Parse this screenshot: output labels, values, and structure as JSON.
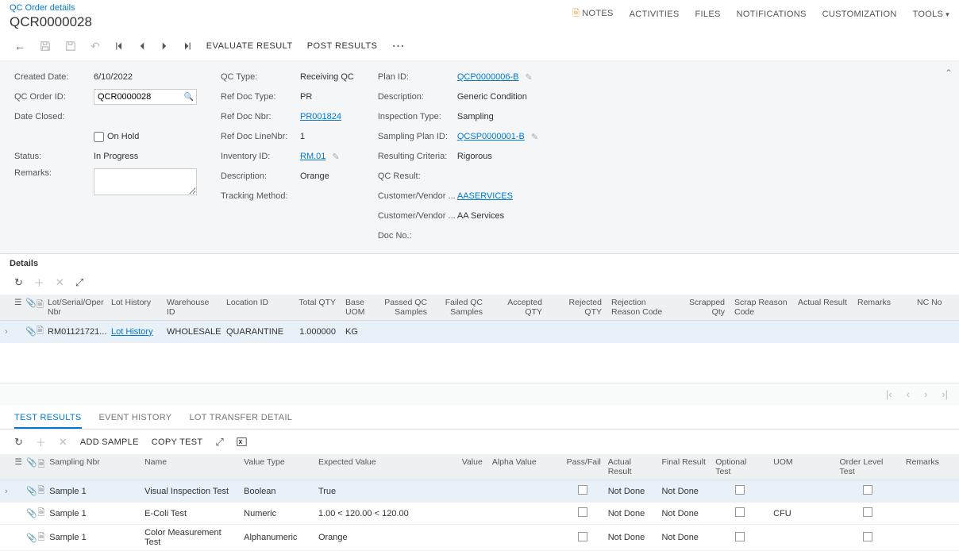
{
  "header": {
    "breadcrumb": "QC Order details",
    "title": "QCR0000028",
    "nav": {
      "notes": "NOTES",
      "activities": "ACTIVITIES",
      "files": "FILES",
      "notifications": "NOTIFICATIONS",
      "customization": "CUSTOMIZATION",
      "tools": "TOOLS"
    }
  },
  "toolbar": {
    "evaluate": "EVALUATE RESULT",
    "post": "POST RESULTS"
  },
  "form": {
    "created_date_label": "Created Date:",
    "created_date": "6/10/2022",
    "qc_order_id_label": "QC Order ID:",
    "qc_order_id": "QCR0000028",
    "date_closed_label": "Date Closed:",
    "date_closed": "",
    "on_hold_label": "On Hold",
    "status_label": "Status:",
    "status": "In Progress",
    "remarks_label": "Remarks:",
    "remarks": "",
    "qc_type_label": "QC Type:",
    "qc_type": "Receiving QC",
    "ref_doc_type_label": "Ref Doc Type:",
    "ref_doc_type": "PR",
    "ref_doc_nbr_label": "Ref Doc Nbr:",
    "ref_doc_nbr": "PR001824",
    "ref_doc_line_label": "Ref Doc LineNbr:",
    "ref_doc_line": "1",
    "inventory_id_label": "Inventory ID:",
    "inventory_id": "RM.01",
    "description_label": "Description:",
    "description": "Orange",
    "tracking_method_label": "Tracking Method:",
    "tracking_method": "",
    "plan_id_label": "Plan ID:",
    "plan_id": "QCP0000006-B",
    "plan_desc_label": "Description:",
    "plan_desc": "Generic Condition",
    "inspection_type_label": "Inspection Type:",
    "inspection_type": "Sampling",
    "sampling_plan_label": "Sampling Plan ID:",
    "sampling_plan": "QCSP0000001-B",
    "resulting_criteria_label": "Resulting Criteria:",
    "resulting_criteria": "Rigorous",
    "qc_result_label": "QC Result:",
    "qc_result": "",
    "cust_vendor_id_label": "Customer/Vendor ...",
    "cust_vendor_id": "AASERVICES",
    "cust_vendor_name_label": "Customer/Vendor ...",
    "cust_vendor_name": "AA Services",
    "doc_no_label": "Doc No.:",
    "doc_no": ""
  },
  "details": {
    "title": "Details",
    "columns": {
      "lot_serial": "Lot/Serial/Oper Nbr",
      "lot_history": "Lot History",
      "warehouse": "Warehouse ID",
      "location": "Location ID",
      "total_qty": "Total QTY",
      "base_uom": "Base UOM",
      "passed_qc": "Passed QC Samples",
      "failed_qc": "Failed QC Samples",
      "accepted_qty": "Accepted QTY",
      "rejected_qty": "Rejected QTY",
      "rejection_reason": "Rejection Reason Code",
      "scrapped_qty": "Scrapped Qty",
      "scrap_reason": "Scrap Reason Code",
      "actual_result": "Actual Result",
      "remarks": "Remarks",
      "nc_no": "NC No"
    },
    "rows": [
      {
        "lot_serial": "RM01121721...",
        "lot_history": "Lot History",
        "warehouse": "WHOLESALE",
        "location": "QUARANTINE",
        "total_qty": "1.000000",
        "base_uom": "KG"
      }
    ]
  },
  "tabs": {
    "test_results": "TEST RESULTS",
    "event_history": "EVENT HISTORY",
    "lot_transfer": "LOT TRANSFER DETAIL"
  },
  "results_toolbar": {
    "add_sample": "ADD SAMPLE",
    "copy_test": "COPY TEST"
  },
  "results": {
    "columns": {
      "sampling_nbr": "Sampling Nbr",
      "name": "Name",
      "value_type": "Value Type",
      "expected_value": "Expected Value",
      "value": "Value",
      "alpha_value": "Alpha Value",
      "pass_fail": "Pass/Fail",
      "actual_result": "Actual Result",
      "final_result": "Final Result",
      "optional_test": "Optional Test",
      "uom": "UOM",
      "order_level_test": "Order Level Test",
      "remarks": "Remarks"
    },
    "rows": [
      {
        "sampling_nbr": "Sample 1",
        "name": "Visual Inspection Test",
        "value_type": "Boolean",
        "expected_value": "True",
        "actual_result": "Not Done",
        "final_result": "Not Done",
        "uom": ""
      },
      {
        "sampling_nbr": "Sample 1",
        "name": "E-Coli Test",
        "value_type": "Numeric",
        "expected_value": "1.00 < 120.00 < 120.00",
        "actual_result": "Not Done",
        "final_result": "Not Done",
        "uom": "CFU"
      },
      {
        "sampling_nbr": "Sample 1",
        "name": "Color Measurement Test",
        "value_type": "Alphanumeric",
        "expected_value": "Orange",
        "actual_result": "Not Done",
        "final_result": "Not Done",
        "uom": ""
      }
    ]
  }
}
